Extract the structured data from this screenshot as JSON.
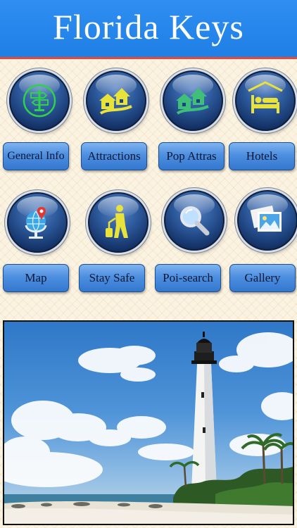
{
  "header": {
    "title": "Florida Keys"
  },
  "menu": {
    "row1": [
      {
        "label": "General Info",
        "icon": "signpost-icon"
      },
      {
        "label": "Attractions",
        "icon": "houses-icon"
      },
      {
        "label": "Pop Attras",
        "icon": "houses-icon"
      },
      {
        "label": "Hotels",
        "icon": "bed-icon"
      }
    ],
    "row2": [
      {
        "label": "Map",
        "icon": "globe-pin-icon"
      },
      {
        "label": "Stay Safe",
        "icon": "traveler-icon"
      },
      {
        "label": "Poi-search",
        "icon": "magnifier-icon"
      },
      {
        "label": "Gallery",
        "icon": "photos-icon"
      }
    ]
  },
  "colors": {
    "header_bg": "#2a8aee",
    "header_border": "#e24a3a",
    "button_bg": "#4d8fe0",
    "orb_bg": "#1d427c",
    "icon_yellow": "#e8e23a"
  }
}
